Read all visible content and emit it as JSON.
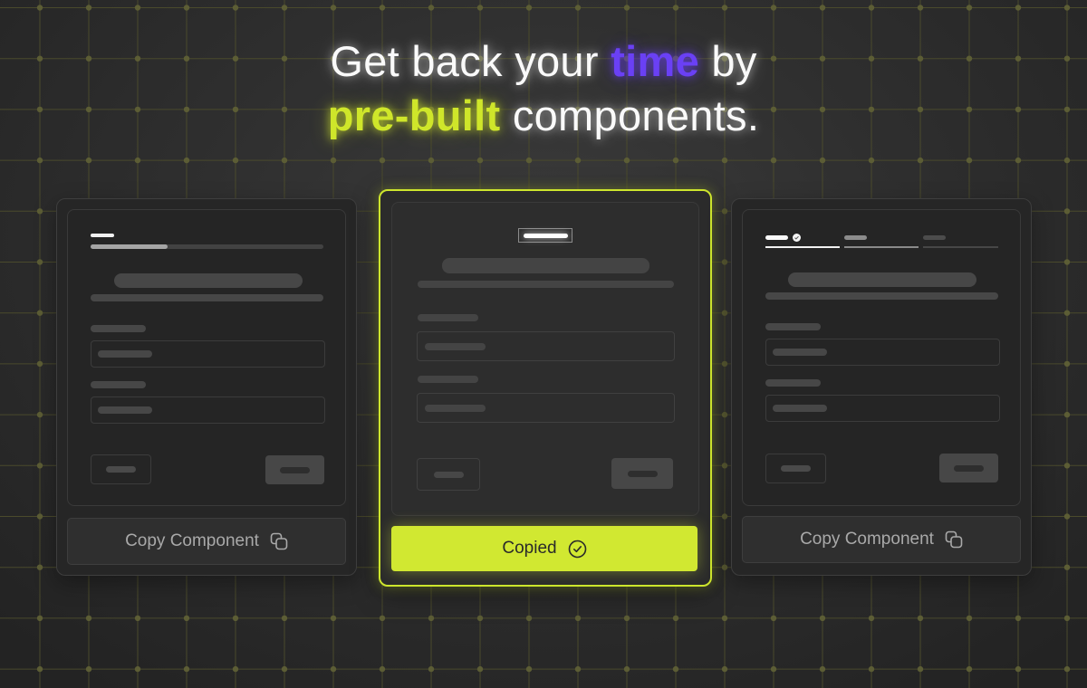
{
  "headline": {
    "line1_prefix": "Get back your",
    "line1_accent": "time",
    "line1_suffix": "by",
    "line2_accent": "pre-built",
    "line2_suffix": "components."
  },
  "colors": {
    "accent_purple": "#6a40f5",
    "accent_lime": "#cfe62a",
    "background": "#2f2f2f",
    "grid_line": "#4a4a2c",
    "grid_dot": "#5c5d35"
  },
  "cards": [
    {
      "variant": "progress-bar-stepper",
      "progress": 0.33,
      "button_label": "Copy Component",
      "button_icon": "copy-icon",
      "state": "default"
    },
    {
      "variant": "single-step-header",
      "button_label": "Copied",
      "button_icon": "check-circle-icon",
      "state": "copied"
    },
    {
      "variant": "segmented-stepper",
      "steps_completed": 1,
      "steps_total": 3,
      "button_label": "Copy Component",
      "button_icon": "copy-icon",
      "state": "default"
    }
  ]
}
